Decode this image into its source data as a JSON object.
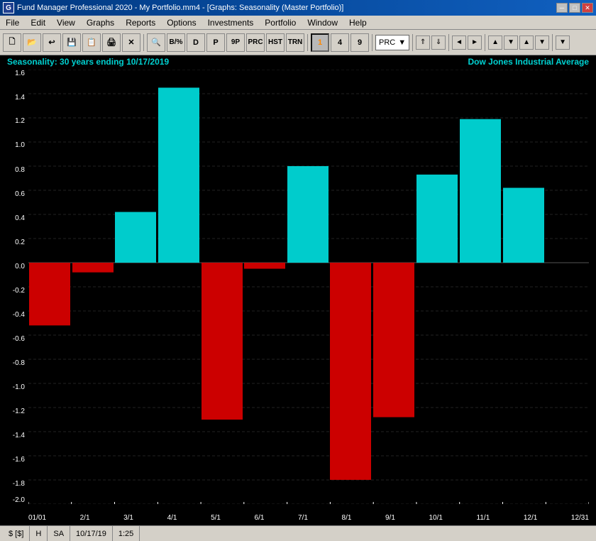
{
  "window": {
    "title": "Fund Manager Professional 2020 - My Portfolio.mm4 - [Graphs: Seasonality (Master Portfolio)]",
    "controls": {
      "minimize": "─",
      "maximize": "□",
      "close": "✕"
    }
  },
  "menu": {
    "items": [
      "File",
      "Edit",
      "View",
      "Graphs",
      "Reports",
      "Options",
      "Investments",
      "Portfolio",
      "Window",
      "Help"
    ]
  },
  "toolbar": {
    "nav_buttons": [
      "◄◄",
      "◄",
      "►",
      "►►"
    ],
    "prc_label": "PRC",
    "numbers": [
      "1",
      "4",
      "9"
    ],
    "labels": [
      "B/%",
      "D",
      "P",
      "9P",
      "PRC",
      "HST",
      "TRN"
    ]
  },
  "chart": {
    "subtitle": "Seasonality: 30 years ending 10/17/2019",
    "title": "Dow Jones Industrial Average",
    "y_axis": {
      "labels": [
        "1.6",
        "1.4",
        "1.2",
        "1.0",
        "0.8",
        "0.6",
        "0.4",
        "0.2",
        "0.0",
        "-0.2",
        "-0.4",
        "-0.6",
        "-0.8",
        "-1.0",
        "-1.2",
        "-1.4",
        "-1.6",
        "-1.8",
        "-2.0"
      ],
      "min": -2.0,
      "max": 1.6
    },
    "x_axis": {
      "labels": [
        "01/01",
        "2/1",
        "3/1",
        "4/1",
        "5/1",
        "6/1",
        "7/1",
        "8/1",
        "9/1",
        "10/1",
        "11/1",
        "12/1",
        "12/31"
      ]
    },
    "bars": [
      {
        "month": "Jan",
        "value": -0.52,
        "color": "red"
      },
      {
        "month": "Feb",
        "value": -0.08,
        "color": "red"
      },
      {
        "month": "Mar",
        "value": 0.42,
        "color": "cyan"
      },
      {
        "month": "Apr",
        "value": 1.45,
        "color": "cyan"
      },
      {
        "month": "May",
        "value": -1.3,
        "color": "red"
      },
      {
        "month": "Jun",
        "value": -0.05,
        "color": "red"
      },
      {
        "month": "Jul",
        "value": 0.8,
        "color": "cyan"
      },
      {
        "month": "Aug",
        "value": -1.8,
        "color": "red"
      },
      {
        "month": "Sep",
        "value": -1.28,
        "color": "red"
      },
      {
        "month": "Oct",
        "value": 0.73,
        "color": "cyan"
      },
      {
        "month": "Nov",
        "value": 1.19,
        "color": "cyan"
      },
      {
        "month": "Dec",
        "value": 0.62,
        "color": "cyan"
      }
    ]
  },
  "status_bar": {
    "currency": "$ [$]",
    "mode": "H",
    "type": "SA",
    "date": "10/17/19",
    "time": "1:25"
  }
}
